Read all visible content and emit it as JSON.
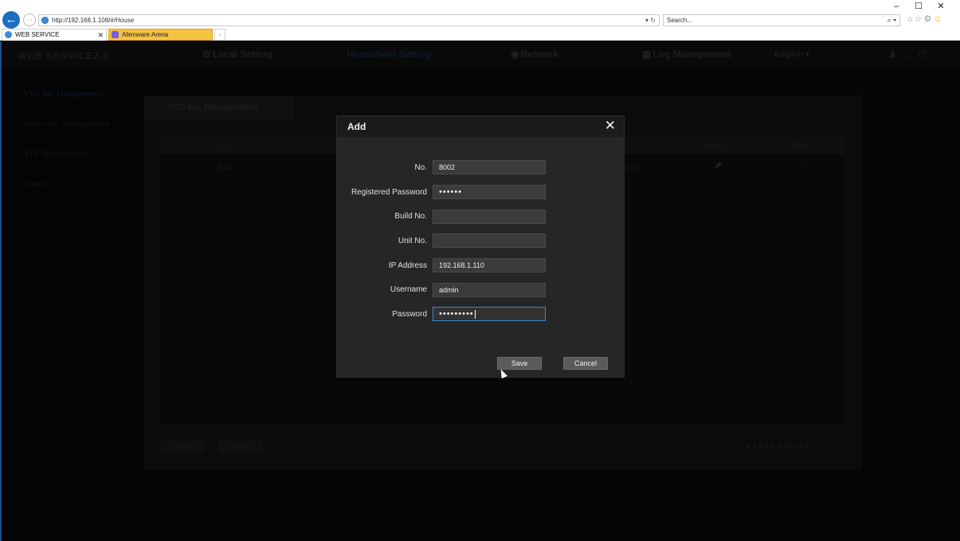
{
  "browser": {
    "url": "http://192.168.1.108/#/House",
    "search_placeholder": "Search...",
    "search_ctrl": "⌕ ▾",
    "address_ctrls": "▾ ↻",
    "window_controls": [
      "–",
      "☐",
      "✕"
    ],
    "tabs": [
      {
        "label": "WEB SERVICE",
        "active": true
      },
      {
        "label": "Alienware Arena",
        "active": false
      }
    ]
  },
  "app": {
    "logo": "WEB SERVICE2.0",
    "nav": {
      "local": "Local Setting",
      "household": "Household Setting",
      "network": "Network",
      "log": "Log Management",
      "language": "English ▾"
    },
    "sidebar": [
      "VTO No. Management",
      "Room No. Management",
      "VTS Management",
      "Status"
    ],
    "content_tab": "VTO No. Management",
    "table": {
      "headers": {
        "no": "No.",
        "modify": "Modify",
        "delete": "Delete"
      },
      "rows": [
        {
          "no": "8001",
          "ip_partial": "106"
        }
      ]
    },
    "footer": {
      "add": "Add",
      "clear": "Clear",
      "pager": "◂ ◂ 1/1 ▸ ▸  Go to       ▸"
    }
  },
  "modal": {
    "title": "Add",
    "fields": {
      "no": {
        "label": "No.",
        "value": "8002"
      },
      "reg_password": {
        "label": "Registered Password",
        "value": "••••••"
      },
      "build_no": {
        "label": "Build No.",
        "value": ""
      },
      "unit_no": {
        "label": "Unit No.",
        "value": ""
      },
      "ip": {
        "label": "IP Address",
        "value": "192.168.1.110"
      },
      "username": {
        "label": "Username",
        "value": "admin"
      },
      "password": {
        "label": "Password",
        "value": "•••••••••"
      }
    },
    "save": "Save",
    "cancel": "Cancel"
  },
  "colors": {
    "accent": "#3d87d6",
    "modal_bg": "#262626",
    "button": "#5a5a5a",
    "browser_back": "#1c6fc0",
    "alien_tab": "#f5c242"
  }
}
